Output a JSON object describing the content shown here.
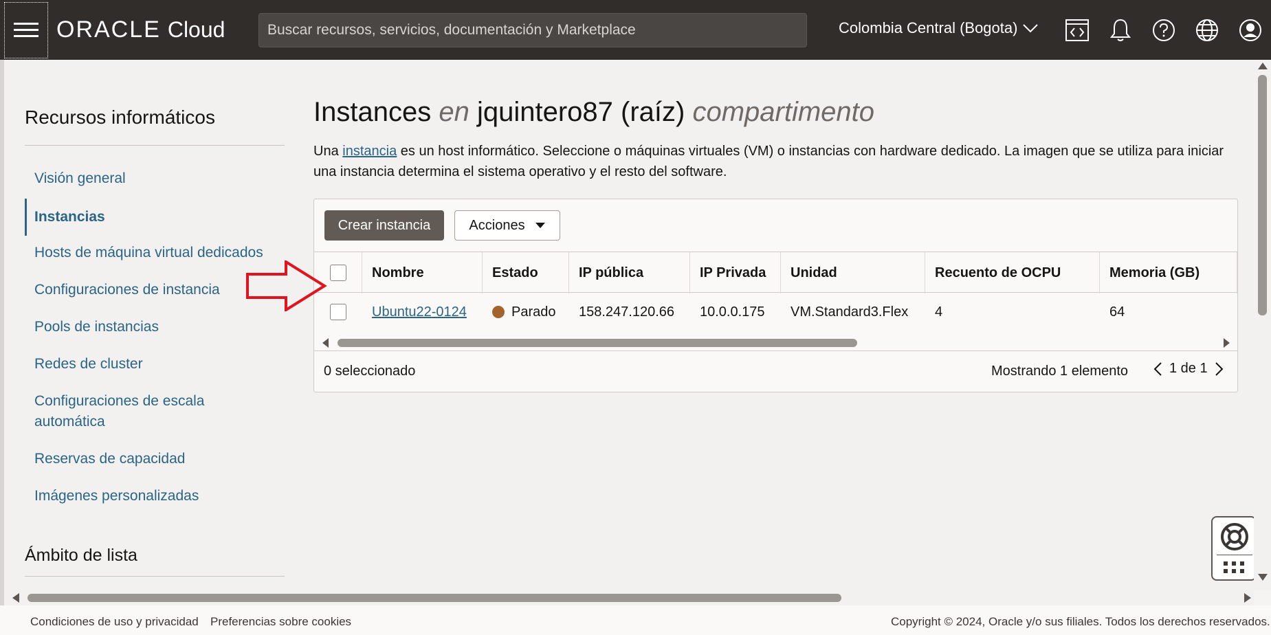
{
  "header": {
    "logo_oracle": "ORACLE",
    "logo_cloud": "Cloud",
    "search_placeholder": "Buscar recursos, servicios, documentación y Marketplace",
    "region": "Colombia Central (Bogota)"
  },
  "sidebar": {
    "title": "Recursos informáticos",
    "items": [
      {
        "label": "Visión general"
      },
      {
        "label": "Instancias"
      },
      {
        "label": "Hosts de máquina virtual dedicados"
      },
      {
        "label": "Configuraciones de instancia"
      },
      {
        "label": "Pools de instancias"
      },
      {
        "label": "Redes de cluster"
      },
      {
        "label": "Configuraciones de escala automática"
      },
      {
        "label": "Reservas de capacidad"
      },
      {
        "label": "Imágenes personalizadas"
      }
    ],
    "scope_title": "Ámbito de lista"
  },
  "main": {
    "title_part1": "Instances",
    "title_en": "en",
    "title_compartment": "jquintero87 (raíz)",
    "title_suffix": "compartimento",
    "desc_before": "Una",
    "desc_link": "instancia",
    "desc_after": "es un host informático. Seleccione o máquinas virtuales (VM) o instancias con hardware dedicado. La imagen que se utiliza para iniciar una instancia determina el sistema operativo y el resto del software.",
    "create_button": "Crear instancia",
    "actions_button": "Acciones",
    "columns": [
      "Nombre",
      "Estado",
      "IP pública",
      "IP Privada",
      "Unidad",
      "Recuento de OCPU",
      "Memoria (GB)"
    ],
    "rows": [
      {
        "name": "Ubuntu22-0124",
        "state": "Parado",
        "public_ip": "158.247.120.66",
        "private_ip": "10.0.0.175",
        "shape": "VM.Standard3.Flex",
        "ocpu": "4",
        "memory": "64"
      }
    ],
    "selected": "0 seleccionado",
    "showing": "Mostrando 1 elemento",
    "page": "1 de 1"
  },
  "colors": {
    "header_bg": "#312d2a",
    "link": "#2a6486",
    "stopped": "#a4622c",
    "arrow": "#e0141e"
  },
  "footer": {
    "terms": "Condiciones de uso y privacidad",
    "cookies": "Preferencias sobre cookies",
    "copyright": "Copyright © 2024, Oracle y/o sus filiales. Todos los derechos reservados."
  }
}
